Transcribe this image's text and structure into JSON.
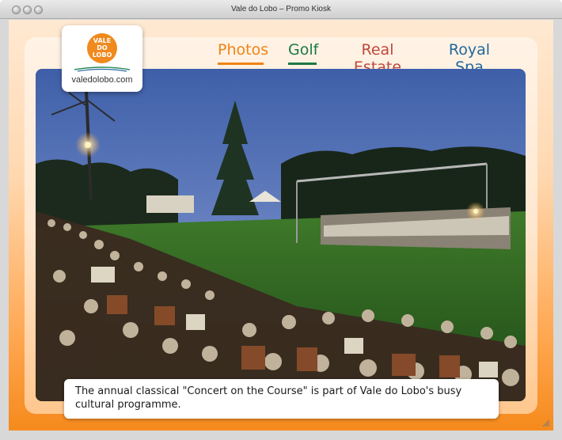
{
  "window": {
    "title": "Vale do Lobo – Promo Kiosk"
  },
  "logo": {
    "mark_text": "VALE DO LOBO",
    "url_text": "valedolobo.com"
  },
  "nav": {
    "items": [
      {
        "label": "Photos",
        "color": "#ef8416"
      },
      {
        "label": "Golf",
        "color": "#1c7846"
      },
      {
        "label": "Real Estate",
        "color": "#c0473a"
      },
      {
        "label": "Royal Spa",
        "color": "#22689a"
      }
    ],
    "active": "Photos"
  },
  "photo": {
    "subject": "outdoor classical concert at dusk"
  },
  "caption": {
    "text": "The annual classical \"Concert on the Course\" is part of Vale do Lobo's busy cultural programme."
  },
  "colors": {
    "accent": "#ef8416",
    "background_bottom": "#f58a1c"
  }
}
